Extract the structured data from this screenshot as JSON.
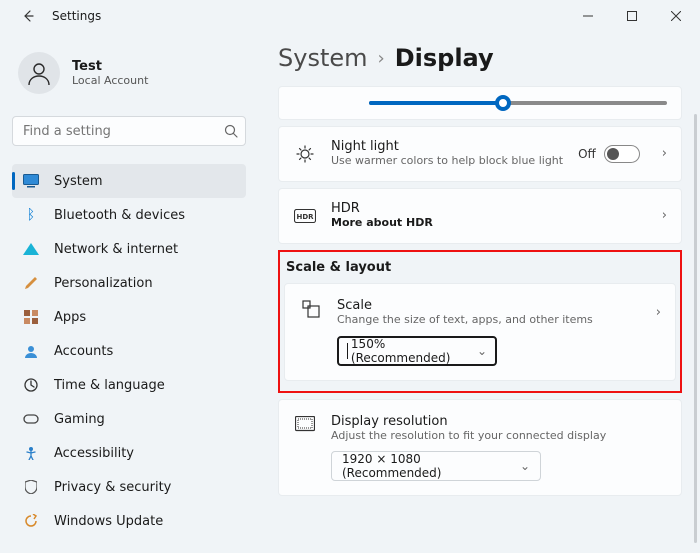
{
  "window": {
    "title": "Settings"
  },
  "user": {
    "name": "Test",
    "sub": "Local Account"
  },
  "search": {
    "placeholder": "Find a setting"
  },
  "sidebar": {
    "items": [
      {
        "label": "System",
        "color": "#0078d4"
      },
      {
        "label": "Bluetooth & devices",
        "color": "#0078d4"
      },
      {
        "label": "Network & internet",
        "color": "#0099e0"
      },
      {
        "label": "Personalization",
        "color": "#d68f3f"
      },
      {
        "label": "Apps",
        "color": "#9b5f3d"
      },
      {
        "label": "Accounts",
        "color": "#3a8fd6"
      },
      {
        "label": "Time & language",
        "color": "#333"
      },
      {
        "label": "Gaming",
        "color": "#444"
      },
      {
        "label": "Accessibility",
        "color": "#2a7fc9"
      },
      {
        "label": "Privacy & security",
        "color": "#555"
      },
      {
        "label": "Windows Update",
        "color": "#d88a2c"
      }
    ]
  },
  "breadcrumb": {
    "parent": "System",
    "current": "Display"
  },
  "night": {
    "title": "Night light",
    "sub": "Use warmer colors to help block blue light",
    "state": "Off"
  },
  "hdr": {
    "title": "HDR",
    "sub": "More about HDR"
  },
  "scale_section": "Scale & layout",
  "scale": {
    "title": "Scale",
    "sub": "Change the size of text, apps, and other items",
    "value": "150% (Recommended)"
  },
  "resolution": {
    "title": "Display resolution",
    "sub": "Adjust the resolution to fit your connected display",
    "value": "1920 × 1080 (Recommended)"
  }
}
